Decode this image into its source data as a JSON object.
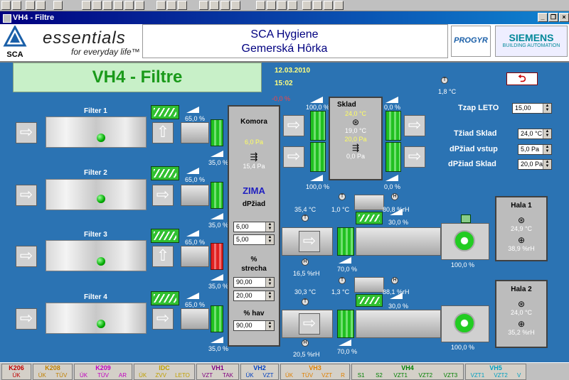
{
  "window": {
    "title": "VH4 - Filtre"
  },
  "header": {
    "brand_sca": "SCA",
    "tagline_main": "essentials",
    "tagline_sub": "for everyday life™",
    "company": "SCA Hygiene",
    "location": "Gemerská Hôrka",
    "progyr": "PROGYR",
    "siemens": "SIEMENS",
    "siemens_sub": "BUILDING AUTOMATION"
  },
  "screen": {
    "title": "VH4 - Filtre",
    "date": "12.03.2010",
    "time": "15:02",
    "outside_temp": "1,8 °C"
  },
  "filters": [
    {
      "label": "Filter 1",
      "pct_top": "65,0 %",
      "pct_bottom": "35,0 %"
    },
    {
      "label": "Filter 2",
      "pct_top": "65,0 %",
      "pct_bottom": "35,0 %"
    },
    {
      "label": "Filter 3",
      "pct_top": "65,0 %",
      "pct_bottom": "35,0 %"
    },
    {
      "label": "Filter 4",
      "pct_top": "65,0 %",
      "pct_bottom": "35,0 %"
    }
  ],
  "komora": {
    "title": "Komora",
    "pressure_set": "6,0 Pa",
    "pressure_act": "15,4 Pa",
    "mode": "ZIMA",
    "dp_label": "dPžiad",
    "dp1": "6,00",
    "dp2": "5,00",
    "roof_label_1": "%",
    "roof_label_2": "strecha",
    "roof1": "90,00",
    "roof2": "20,00",
    "hav_label": "% hav",
    "hav": "90,00"
  },
  "sklad": {
    "title": "Sklad",
    "temp_set": "24,0 °C",
    "temp_act": "19,0 °C",
    "p_set": "20,0 Pa",
    "p_act": "0,0 Pa",
    "dmp_left_top": "100,0 %",
    "dmp_right_top": "0,0 %",
    "dmp_left_bot": "100,0 %",
    "dmp_right_bot": "0,0 %",
    "alarm": "-0,0 %"
  },
  "settings": [
    {
      "label": "Tzap LETO",
      "value": "15,00"
    },
    {
      "label": "Tžiad Sklad",
      "value": "24,0 °C"
    },
    {
      "label": "dPžiad vstup",
      "value": "5,0 Pa"
    },
    {
      "label": "dPžiad Sklad",
      "value": "20,0 Pa"
    }
  ],
  "line1": {
    "t_in": "35,4 °C",
    "rh_in": "16,5 %rH",
    "t_amb": "1,0 °C",
    "rh_amb": "80,8 %rH",
    "dmp_top": "30,0 %",
    "dmp_bot": "70,0 %",
    "fan": "100,0 %"
  },
  "line2": {
    "t_in": "30,3 °C",
    "rh_in": "20,5 %rH",
    "t_amb": "1,3 °C",
    "rh_amb": "88,1 %rH",
    "dmp_top": "30,0 %",
    "dmp_bot": "70,0 %",
    "fan": "100,0 %"
  },
  "hala1": {
    "title": "Hala 1",
    "temp": "24,9 °C",
    "rh": "38,9 %rH"
  },
  "hala2": {
    "title": "Hala 2",
    "temp": "24,0 °C",
    "rh": "35,2 %rH"
  },
  "bottom_groups": [
    {
      "name": "K206",
      "color": "#c00000",
      "subs": [
        "ÚK"
      ]
    },
    {
      "name": "K208",
      "color": "#c08000",
      "subs": [
        "ÚK",
        "TÚV"
      ]
    },
    {
      "name": "K209",
      "color": "#c000c0",
      "subs": [
        "ÚK",
        "TÚV",
        "AR"
      ]
    },
    {
      "name": "IDC",
      "color": "#c0a000",
      "subs": [
        "ÚK",
        "ZVV",
        "LETO"
      ]
    },
    {
      "name": "VH1",
      "color": "#800080",
      "subs": [
        "VZT",
        "TAK"
      ]
    },
    {
      "name": "VH2",
      "color": "#0040c0",
      "subs": [
        "ÚK",
        "VZT"
      ]
    },
    {
      "name": "VH3",
      "color": "#e08000",
      "subs": [
        "ÚK",
        "TÚV",
        "VZT",
        "R"
      ]
    },
    {
      "name": "VH4",
      "color": "#008000",
      "subs": [
        "S1",
        "S2",
        "VZT1",
        "VZT2",
        "VZT3"
      ]
    },
    {
      "name": "VH5",
      "color": "#00a0c0",
      "subs": [
        "VZT1",
        "VZT2",
        "V"
      ]
    }
  ]
}
